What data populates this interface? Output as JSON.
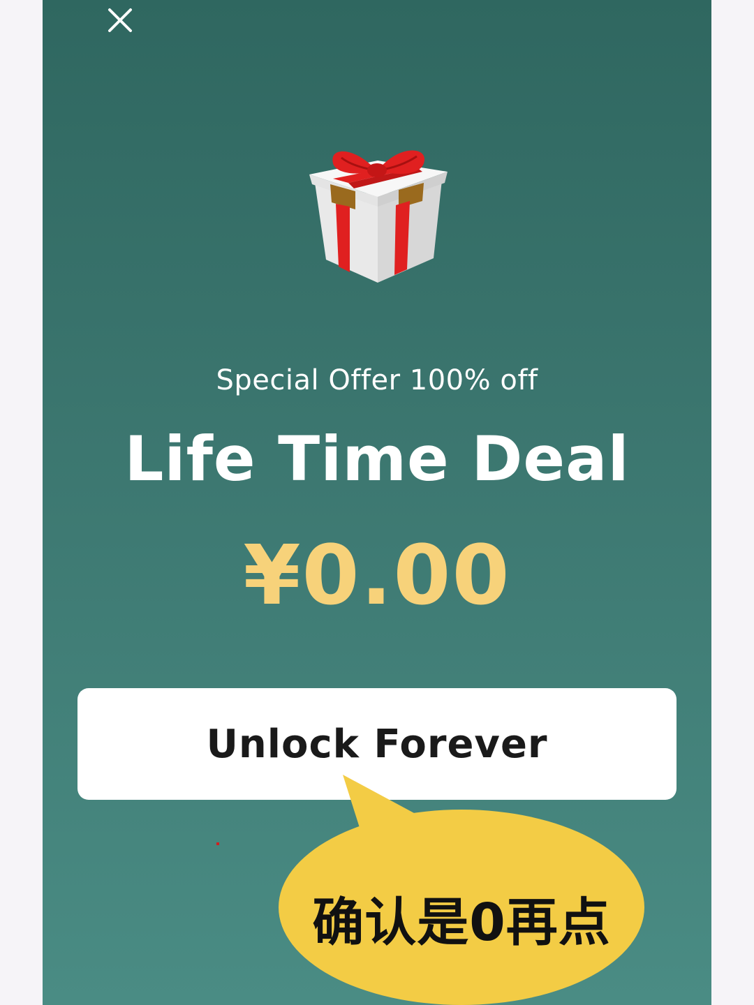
{
  "offer": {
    "subtitle": "Special Offer 100% off",
    "title": "Life Time Deal",
    "price": "¥0.00"
  },
  "actions": {
    "unlock_label": "Unlock Forever",
    "close_icon": "close-icon"
  },
  "annotation": {
    "callout_text": "确认是0再点"
  },
  "icons": {
    "gift": "gift-icon"
  },
  "colors": {
    "panel_top": "#2f6760",
    "panel_bottom": "#4a8c84",
    "price": "#f7d27a",
    "callout": "#f3cc45",
    "button": "#ffffff"
  }
}
